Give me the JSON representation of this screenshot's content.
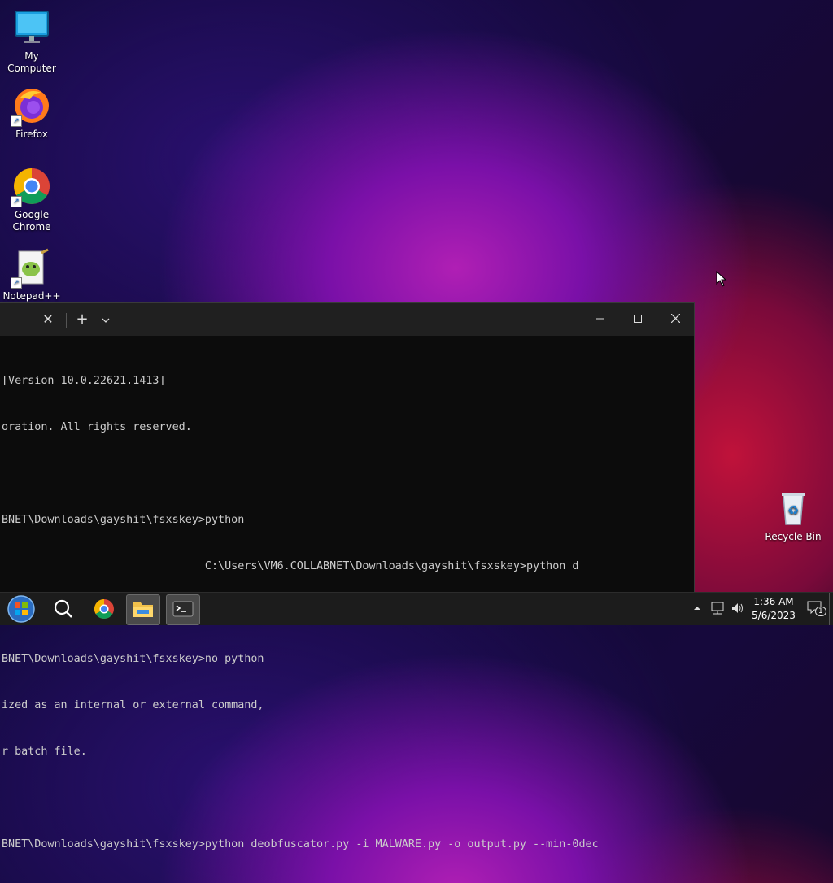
{
  "desktop": {
    "icons": [
      {
        "label": "My Computer",
        "icon": "monitor-icon"
      },
      {
        "label": "Firefox",
        "icon": "firefox-icon"
      },
      {
        "label": "Google\nChrome",
        "icon": "chrome-icon"
      },
      {
        "label": "Notepad++",
        "icon": "notepadpp-icon"
      },
      {
        "label": "Recycle Bin",
        "icon": "recycle-bin-icon"
      }
    ]
  },
  "terminal": {
    "tab_close": "✕",
    "new_tab": "+",
    "dropdown": "⌄",
    "minimize": "—",
    "maximize": "☐",
    "close": "✕",
    "lines": [
      "[Version 10.0.22621.1413]",
      "oration. All rights reserved.",
      "",
      "BNET\\Downloads\\gayshit\\fsxskey>python",
      "                               C:\\Users\\VM6.COLLABNET\\Downloads\\gayshit\\fsxskey>python d",
      "",
      "BNET\\Downloads\\gayshit\\fsxskey>no python",
      "ized as an internal or external command,",
      "r batch file.",
      "",
      "BNET\\Downloads\\gayshit\\fsxskey>python deobfuscator.py -i MALWARE.py -o output.py --min-0dec"
    ]
  },
  "taskbar": {
    "time": "1:36 AM",
    "date": "5/6/2023",
    "notification_count": "1",
    "colors": {
      "bg": "#1c1c1c",
      "accent": "#1e6fd0"
    }
  }
}
